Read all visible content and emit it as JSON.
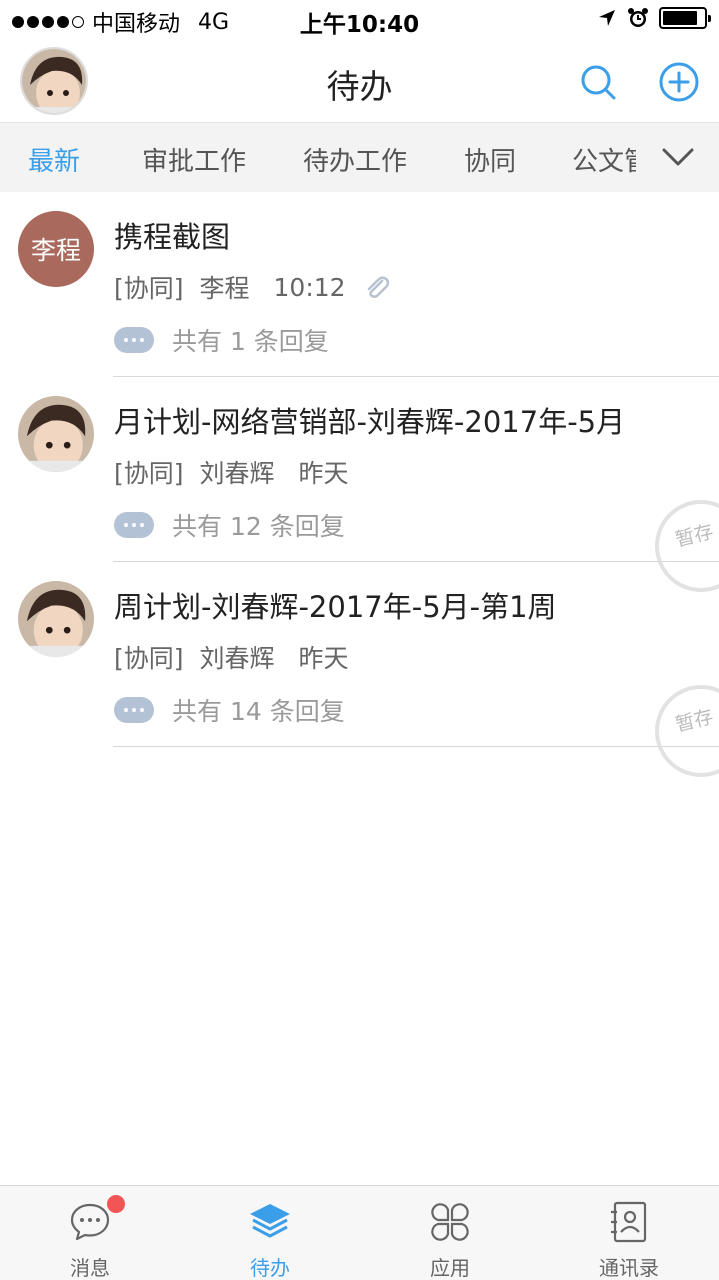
{
  "status_bar": {
    "carrier": "中国移动",
    "network": "4G",
    "time": "上午10:40"
  },
  "nav": {
    "title": "待办"
  },
  "tabs": [
    {
      "label": "最新",
      "active": true
    },
    {
      "label": "审批工作",
      "active": false
    },
    {
      "label": "待办工作",
      "active": false
    },
    {
      "label": "协同",
      "active": false
    },
    {
      "label": "公文管",
      "active": false
    }
  ],
  "items": [
    {
      "avatar_text": "李程",
      "title": "携程截图",
      "type": "[协同]",
      "sender": "李程",
      "time": "10:12",
      "reply": "共有 1 条回复",
      "has_attachment": true,
      "stamp": ""
    },
    {
      "avatar_text": "",
      "title": "月计划-网络营销部-刘春辉-2017年-5月",
      "type": "[协同]",
      "sender": "刘春辉",
      "time": "昨天",
      "reply": "共有 12 条回复",
      "has_attachment": false,
      "stamp": "暂存"
    },
    {
      "avatar_text": "",
      "title": "周计划-刘春辉-2017年-5月-第1周",
      "type": "[协同]",
      "sender": "刘春辉",
      "time": "昨天",
      "reply": "共有 14 条回复",
      "has_attachment": false,
      "stamp": "暂存"
    }
  ],
  "tabbar": [
    {
      "label": "消息",
      "icon": "message-icon",
      "active": false,
      "badge": true
    },
    {
      "label": "待办",
      "icon": "layers-icon",
      "active": true,
      "badge": false
    },
    {
      "label": "应用",
      "icon": "apps-icon",
      "active": false,
      "badge": false
    },
    {
      "label": "通讯录",
      "icon": "contacts-icon",
      "active": false,
      "badge": false
    }
  ],
  "colors": {
    "accent": "#3a9ee8",
    "avatar_bg": "#a9695c",
    "badge": "#f15555"
  }
}
